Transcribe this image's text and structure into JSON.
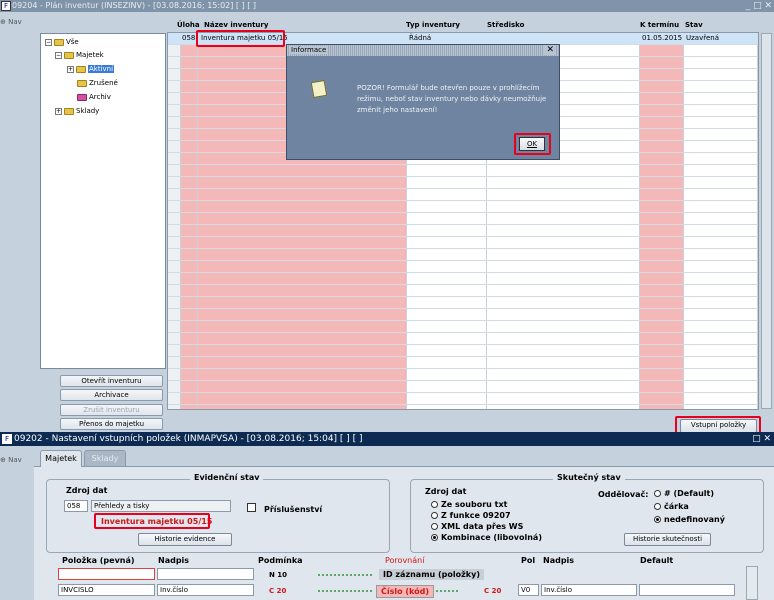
{
  "win1": {
    "title": "09204 - Plán inventur (INSEZINV) - [03.08.2016; 15:02] [ ] [ ]",
    "controls": "_ □ ✕",
    "nav": "Nav"
  },
  "tree": {
    "items": [
      "Vše",
      "Majetek",
      "Aktivní",
      "Zrušené",
      "Archiv",
      "Sklady"
    ]
  },
  "leftbuttons": {
    "otevrit": "Otevřít inventuru",
    "archivace": "Archivace",
    "zrusit": "Zrušit inventuru",
    "prenos": "Přenos do majetku"
  },
  "grid": {
    "headers": {
      "uloha": "Úloha",
      "nazev": "Název inventury",
      "typ": "Typ inventury",
      "stredisko": "Středisko",
      "termin": "K termínu",
      "stav": "Stav"
    },
    "rows": [
      {
        "uloha": "058",
        "nazev": "Inventura majetku 05/15",
        "typ": "Řádná",
        "stredisko": "",
        "termin": "01.05.2015",
        "stav": "Uzavřená"
      }
    ]
  },
  "vstupni_button": "Vstupní položky",
  "modal": {
    "title": "Informace",
    "close": "✕",
    "message": "POZOR! Formulář bude otevřen pouze v prohlížecím režimu, neboť stav inventury nebo dávky neumožňuje změnit jeho nastavení!",
    "ok": "OK"
  },
  "win2": {
    "title": "09202 - Nastavení vstupních položek (INMAPVSA) - [03.08.2016; 15:04] [ ] [ ]",
    "controls": "□ ✕",
    "nav": "Nav"
  },
  "tabs": {
    "majetek": "Majetek",
    "sklady": "Sklady"
  },
  "evidencni": {
    "title": "Evidenční stav",
    "zdroj_label": "Zdroj dat",
    "zdroj_code": "058",
    "zdroj_name": "Přehledy a tisky",
    "inventura": "Inventura majetku 05/15",
    "prislusenstvi": "Příslušenství",
    "historie": "Historie evidence"
  },
  "skutecny": {
    "title": "Skutečný stav",
    "zdroj_label": "Zdroj dat",
    "sources": [
      "Ze souboru txt",
      "Z funkce 09207",
      "XML data přes WS",
      "Kombinace (libovolná)"
    ],
    "oddelovac_label": "Oddělovač:",
    "oddelovac": [
      "# (Default)",
      "čárka",
      "nedefinovaný"
    ],
    "historie": "Historie skutečnosti"
  },
  "mapping": {
    "headers": {
      "polozka": "Položka  (pevná)",
      "nadpis": "Nadpis",
      "podminka": "Podmínka",
      "porovnani": "Porovnání",
      "pol": "Pol",
      "nadpis2": "Nadpis",
      "default": "Default"
    },
    "row1": {
      "podminka": "N 10",
      "porovnani": "ID záznamu (položky)"
    },
    "row2": {
      "polozka": "INVCISLO",
      "nadpis": "Inv.číslo",
      "podminka": "C 20",
      "porovnani": "Číslo (kód)",
      "c20": "C 20",
      "pol": "V0",
      "nadpis2": "Inv.číslo"
    }
  },
  "colors": {
    "accent_red": "#e8001c",
    "pink": "#f4b8b8",
    "selrow": "#cfe3f7",
    "title_dark": "#0d2b52"
  }
}
